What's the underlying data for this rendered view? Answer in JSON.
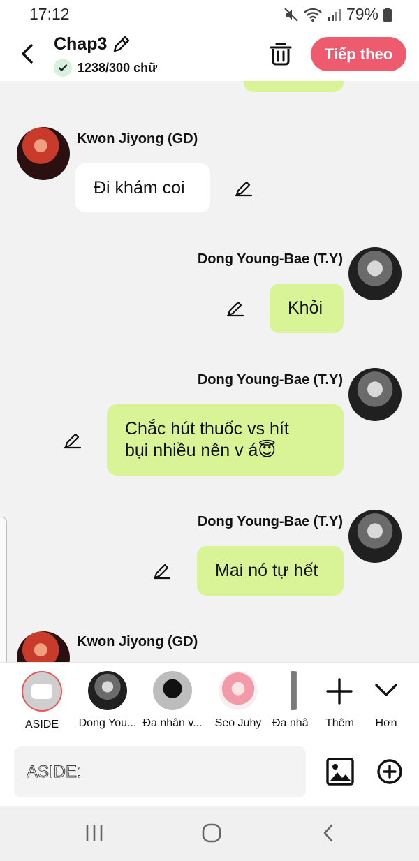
{
  "status_bar": {
    "time": "17:12",
    "battery": "79%"
  },
  "header": {
    "title": "Chap3",
    "word_count": "1238/300 chữ",
    "next_label": "Tiếp theo"
  },
  "messages": [
    {
      "speaker": "Kwon Jiyong (GD)",
      "text": "Đi khám coi",
      "side": "left"
    },
    {
      "speaker": "Dong Young-Bae (T.Y)",
      "text": "Khỏi",
      "side": "right"
    },
    {
      "speaker": "Dong Young-Bae (T.Y)",
      "text_line1": "Chắc hút thuốc vs hít",
      "text_line2": "bụi nhiều nên v á😇",
      "side": "right"
    },
    {
      "speaker": "Dong Young-Bae (T.Y)",
      "text": "Mai nó tự hết",
      "side": "right"
    },
    {
      "speaker": "Kwon Jiyong (GD)",
      "side": "left"
    }
  ],
  "characters": [
    {
      "label": "ASIDE"
    },
    {
      "label": "Dong You..."
    },
    {
      "label": "Đa nhân v..."
    },
    {
      "label": "Seo Juhy"
    },
    {
      "label": "Đa nhâ"
    }
  ],
  "actions": {
    "add_label": "Thêm",
    "more_label": "Hơn"
  },
  "input": {
    "placeholder": "ASIDE:"
  },
  "colors": {
    "accent": "#ef5b6e",
    "bubble_right": "#d8f497",
    "bubble_left": "#ffffff",
    "background": "#f2f2f2"
  }
}
